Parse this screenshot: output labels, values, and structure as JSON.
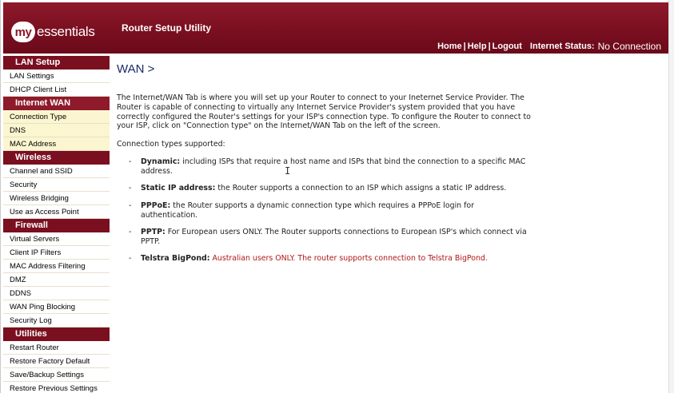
{
  "header": {
    "logo_my": "my",
    "logo_rest": "essentials",
    "app_title": "Router Setup Utility",
    "links": [
      "Home",
      "Help",
      "Logout"
    ],
    "internet_status_label": "Internet Status:",
    "internet_status_value": "No Connection"
  },
  "sidebar": {
    "sections": [
      {
        "title": "LAN Setup",
        "items": [
          "LAN Settings",
          "DHCP Client List"
        ]
      },
      {
        "title": "Internet WAN",
        "items": [
          "Connection Type",
          "DNS",
          "MAC Address"
        ]
      },
      {
        "title": "Wireless",
        "items": [
          "Channel and SSID",
          "Security",
          "Wireless Bridging",
          "Use as Access Point"
        ]
      },
      {
        "title": "Firewall",
        "items": [
          "Virtual Servers",
          "Client IP Filters",
          "MAC Address Filtering",
          "DMZ",
          "DDNS",
          "WAN Ping Blocking",
          "Security Log"
        ]
      },
      {
        "title": "Utilities",
        "items": [
          "Restart Router",
          "Restore Factory Default",
          "Save/Backup Settings",
          "Restore Previous Settings"
        ]
      }
    ]
  },
  "main": {
    "title": "WAN >",
    "intro": "The Internet/WAN Tab is where you will set up your Router to connect to your Ineternet Service Provider. The Router is capable of connecting to virtually any Internet Service Provider's system provided that you have correctly configured the Router's settings for your ISP's connection type. To configure the Router to connect to your ISP, click on \"Connection type\" on the Internet/WAN Tab on the left of the screen.",
    "types_heading": "Connection types supported:",
    "types": [
      {
        "name": "Dynamic:",
        "desc": "including ISPs that require a host name and ISPs that bind the connection to a specific MAC address."
      },
      {
        "name": "Static IP address:",
        "desc": "the Router supports a connection to an ISP which assigns a static IP address."
      },
      {
        "name": "PPPoE:",
        "desc": "the Router supports a dynamic connection type which requires a PPPoE login for authentication."
      },
      {
        "name": "PPTP:",
        "desc": "For European users ONLY. The Router supports connections to European ISP's which connect via PPTP."
      },
      {
        "name": "Telstra BigPond:",
        "desc": "Australian users ONLY. The router supports connection to Telstra BigPond."
      }
    ]
  },
  "colors": {
    "header_bg": "#7a0f20",
    "title_blue": "#1a2a66",
    "highlight_yellow": "#fbf6cf",
    "bigpond_red": "#b01818"
  }
}
